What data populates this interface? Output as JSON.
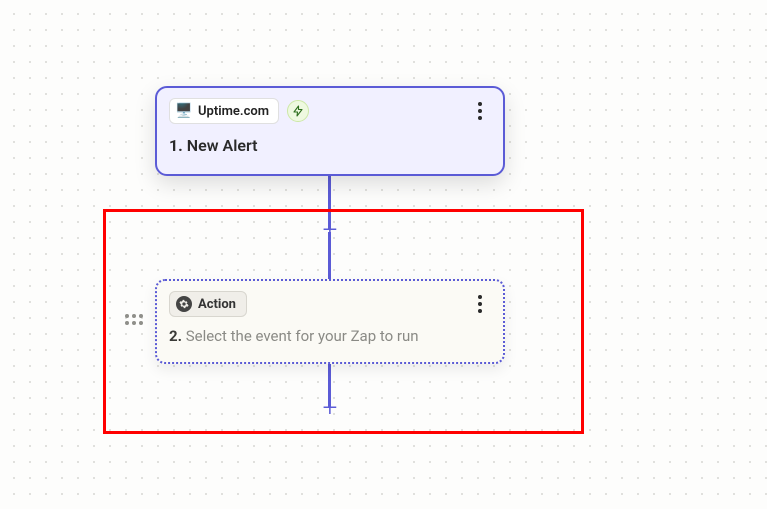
{
  "trigger": {
    "app_name": "Uptime.com",
    "app_icon_glyph": "🖥️",
    "trigger_type_icon": "bolt",
    "step_number": "1.",
    "step_title": "New Alert"
  },
  "action": {
    "chip_label": "Action",
    "step_number": "2.",
    "step_title_placeholder": "Select the event for your Zap to run"
  },
  "buttons": {
    "add_step_glyph": "+"
  }
}
